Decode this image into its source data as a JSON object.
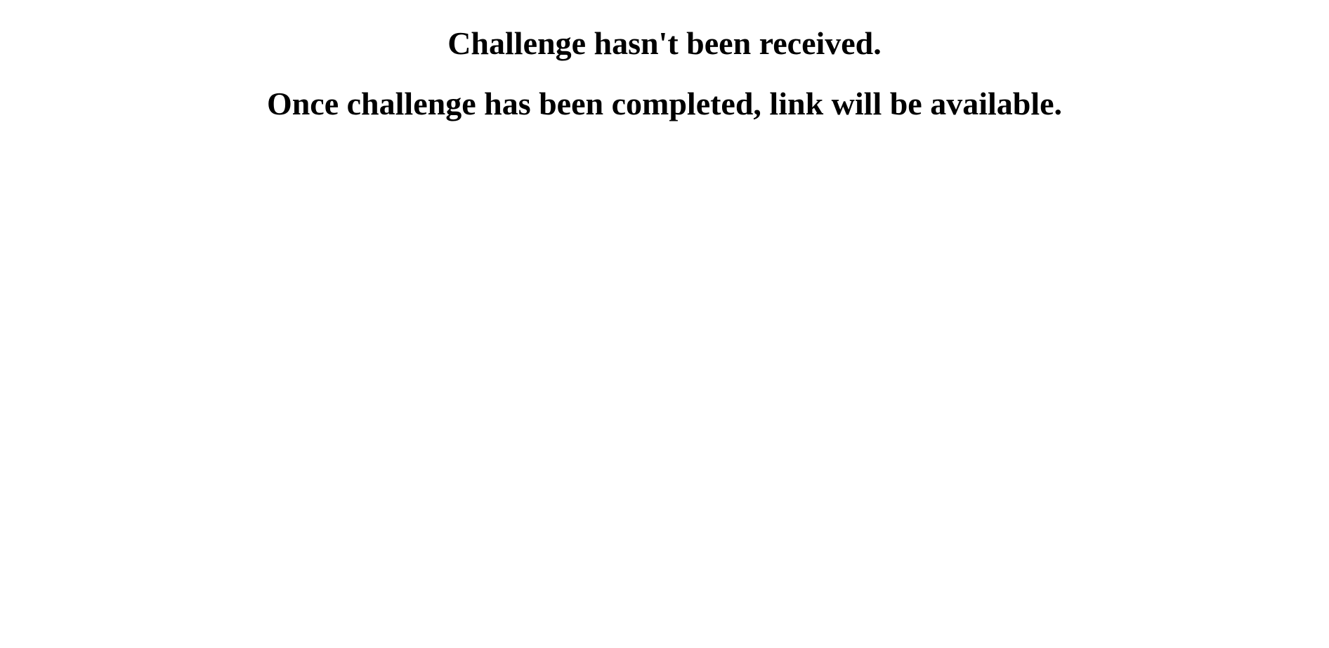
{
  "page": {
    "headline": "Challenge hasn't been received.",
    "message": "Once challenge has been completed, link will be available."
  }
}
